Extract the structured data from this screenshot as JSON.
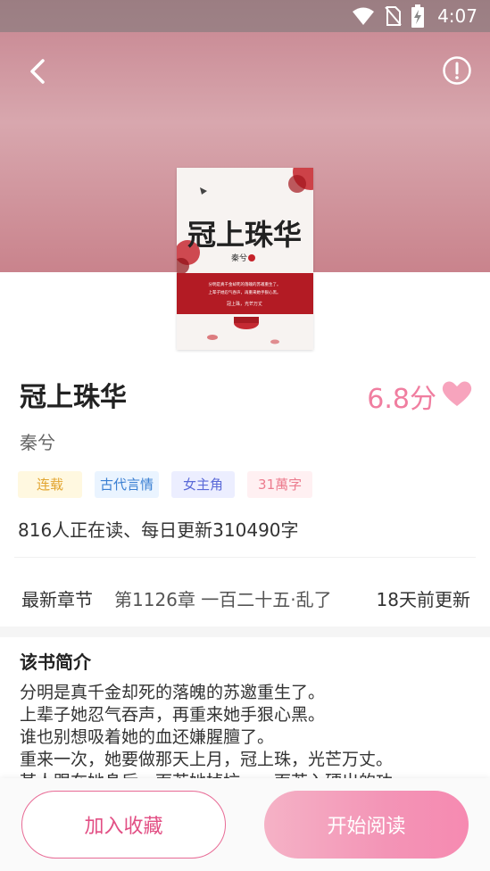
{
  "status_bar": {
    "time": "4:07",
    "icons": [
      "wifi-icon",
      "no-sim-icon",
      "battery-charging-icon"
    ]
  },
  "header": {
    "back_icon": "chevron-left-icon",
    "info_icon": "exclamation-circle-icon"
  },
  "cover": {
    "title_calligraphy": "冠上珠华",
    "author_stamp": "秦兮",
    "blurb_lines": [
      "分明是真千金却死的落魄的苏邀重生了。",
      "上辈子她忍气吞声，再重来她手狠心黑。",
      "冠上珠，光芒万丈"
    ]
  },
  "book": {
    "title": "冠上珠华",
    "score": "6.8分",
    "author": "秦兮",
    "tags": [
      "连载",
      "古代言情",
      "女主角",
      "31萬字"
    ],
    "readers_text": "816人正在读、每日更新310490字"
  },
  "latest": {
    "label": "最新章节",
    "chapter": "第1126章 一百二十五·乱了",
    "time": "18天前更新"
  },
  "intro": {
    "title": "该书简介",
    "lines": [
      "分明是真千金却死的落魄的苏邀重生了。",
      "上辈子她忍气吞声，再重来她手狠心黑。",
      "谁也别想吸着她的血还嫌腥膻了。",
      "重来一次，她要做那天上月，冠上珠，光芒万丈。",
      "某人跟在她身后，面若她掉坑……面若入硬出的功"
    ]
  },
  "actions": {
    "favorite_label": "加入收藏",
    "read_label": "开始阅读"
  },
  "colors": {
    "accent": "#f07ea0",
    "hero_top": "#c6848f",
    "button_pink": "#f394b6"
  }
}
